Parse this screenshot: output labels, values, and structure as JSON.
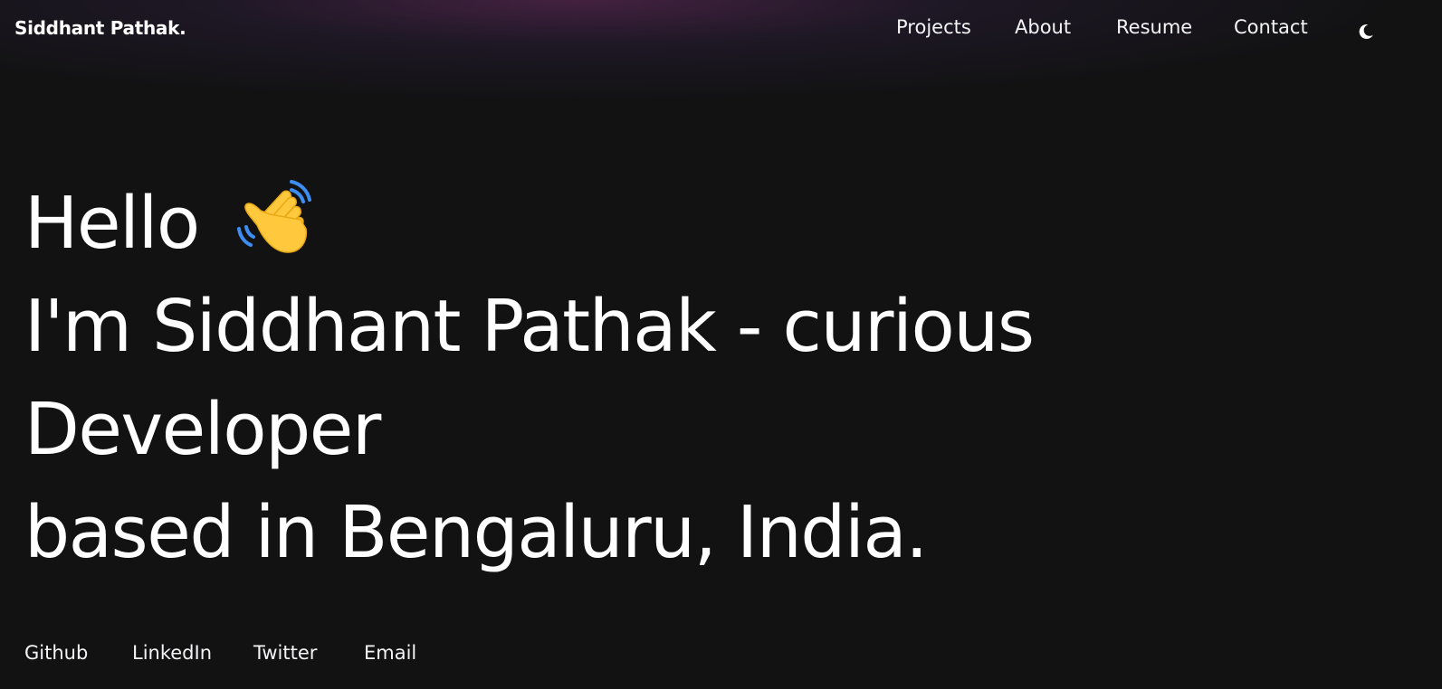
{
  "header": {
    "brand": "Siddhant Pathak.",
    "nav": [
      {
        "label": "Projects"
      },
      {
        "label": "About"
      },
      {
        "label": "Resume"
      },
      {
        "label": "Contact"
      }
    ],
    "theme_toggle_icon": "moon-icon"
  },
  "hero": {
    "greeting": "Hello",
    "greeting_icon": "waving-hand-icon",
    "line1": "I'm Siddhant Pathak - curious",
    "line2": "Developer",
    "line3": "based in Bengaluru, India."
  },
  "social": [
    {
      "label": "Github"
    },
    {
      "label": "LinkedIn"
    },
    {
      "label": "Twitter"
    },
    {
      "label": "Email"
    }
  ],
  "colors": {
    "background": "#121213",
    "text": "#ffffff",
    "header_glow": "#4c2448",
    "wave_hand": "#ffc83d",
    "wave_lines": "#3e8ef2"
  }
}
